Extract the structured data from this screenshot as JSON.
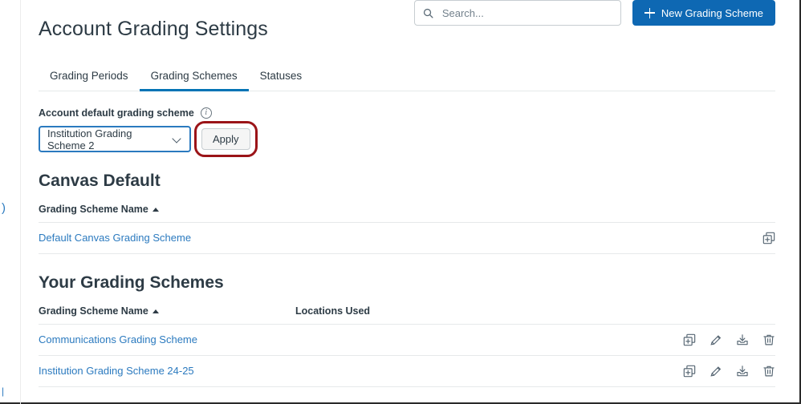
{
  "page": {
    "title": "Account Grading Settings"
  },
  "tabs": [
    {
      "label": "Grading Periods",
      "name": "tab-grading-periods",
      "active": false
    },
    {
      "label": "Grading Schemes",
      "name": "tab-grading-schemes",
      "active": true
    },
    {
      "label": "Statuses",
      "name": "tab-statuses",
      "active": false
    }
  ],
  "default_scheme": {
    "label": "Account default grading scheme",
    "info_icon": "info-icon",
    "info_glyph": "i",
    "selected": "Institution Grading Scheme 2",
    "chevron_icon": "chevron-down-icon",
    "apply_label": "Apply",
    "highlight_color": "#9b1418"
  },
  "search": {
    "placeholder": "Search...",
    "value": "",
    "icon": "search-icon"
  },
  "new_scheme_button": {
    "label": "New Grading Scheme",
    "icon": "plus-icon",
    "color": "#0e68b3"
  },
  "canvas_default": {
    "heading": "Canvas Default",
    "columns": [
      "Grading Scheme Name"
    ],
    "sort_caret": "caret-up-icon",
    "rows": [
      {
        "name": "Default Canvas Grading Scheme",
        "actions": [
          "duplicate-icon"
        ]
      }
    ]
  },
  "your_schemes": {
    "heading": "Your Grading Schemes",
    "columns": [
      "Grading Scheme Name",
      "Locations Used"
    ],
    "sort_caret": "caret-up-icon",
    "rows": [
      {
        "name": "Communications Grading Scheme",
        "locations_used": "",
        "actions": [
          "duplicate-icon",
          "edit-pencil-icon",
          "export-download-icon",
          "delete-trash-icon"
        ]
      },
      {
        "name": "Institution Grading Scheme 24-25",
        "locations_used": "",
        "actions": [
          "duplicate-icon",
          "edit-pencil-icon",
          "export-download-icon",
          "delete-trash-icon"
        ]
      }
    ]
  },
  "edge_glyphs": {
    "upper": ")",
    "lower": "|"
  }
}
